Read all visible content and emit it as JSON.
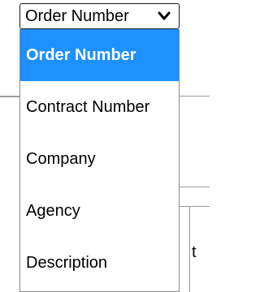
{
  "select": {
    "current_value": "Order Number",
    "icon": "chevron-down-icon"
  },
  "dropdown": {
    "options": [
      {
        "label": "Order Number",
        "selected": true
      },
      {
        "label": "Contract Number",
        "selected": false
      },
      {
        "label": "Company",
        "selected": false
      },
      {
        "label": "Agency",
        "selected": false
      },
      {
        "label": "Description",
        "selected": false
      }
    ]
  },
  "background": {
    "partial_text": "t"
  },
  "colors": {
    "selected_bg": "#1e90ff",
    "selected_text": "#ffffff",
    "text": "#000000"
  }
}
